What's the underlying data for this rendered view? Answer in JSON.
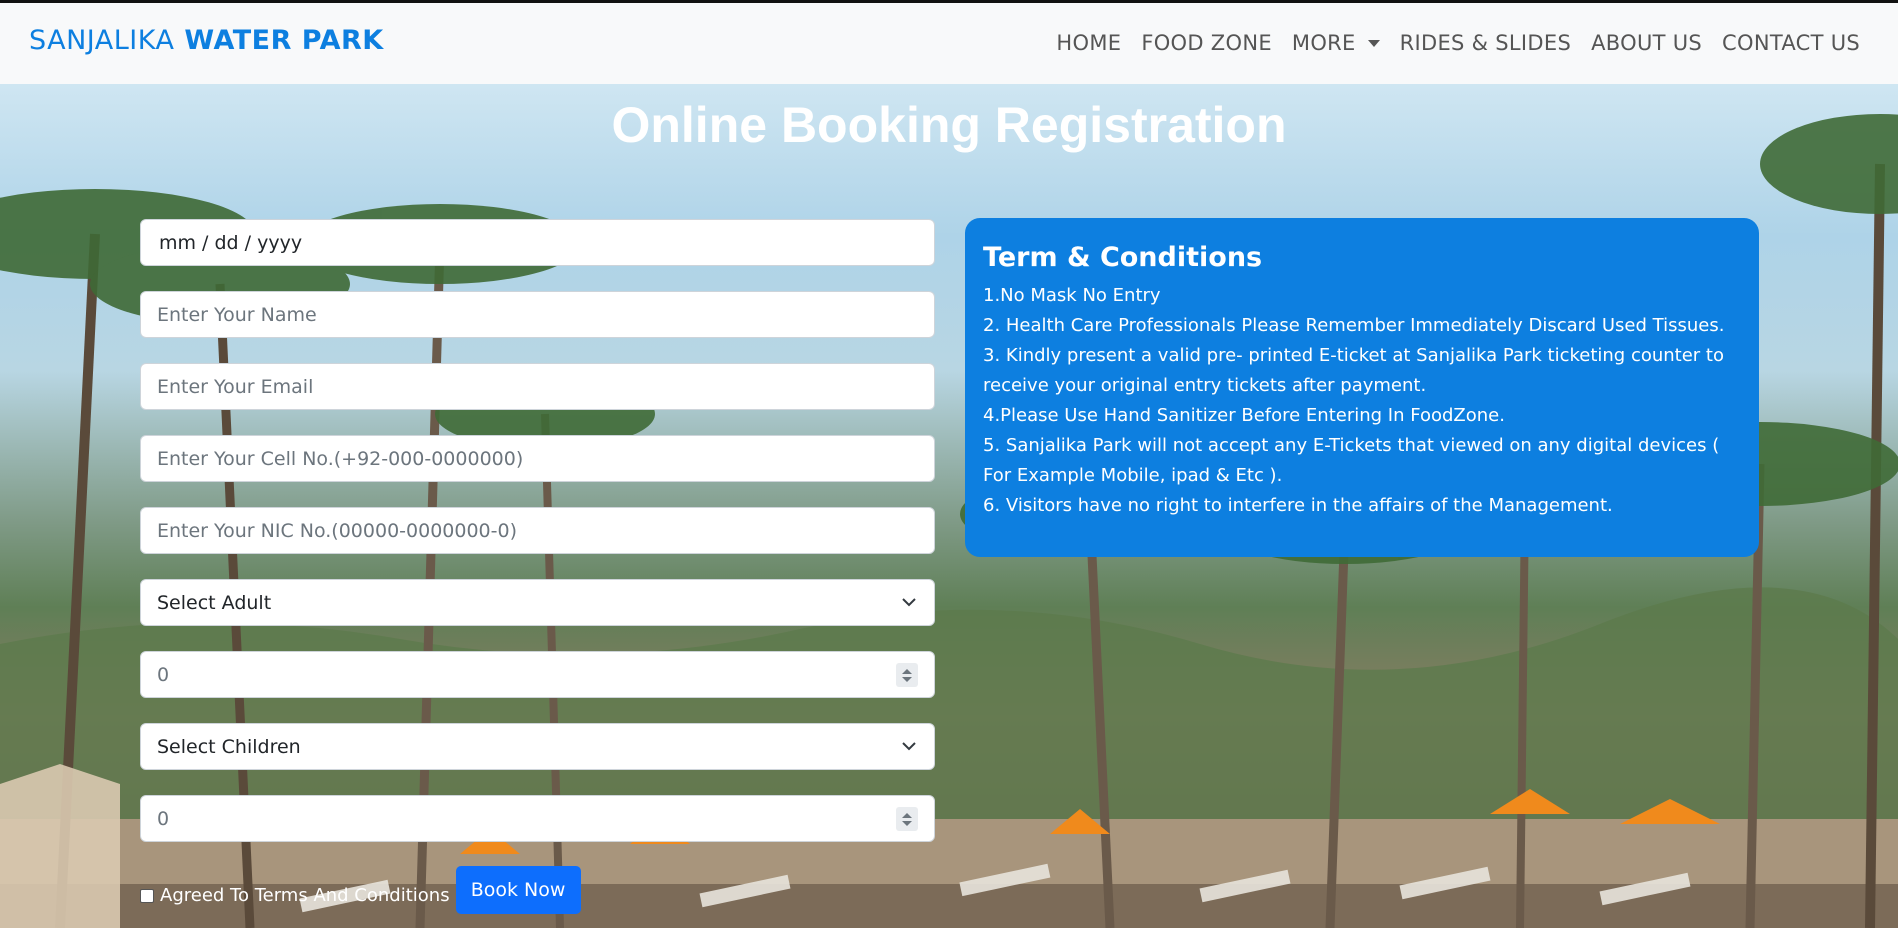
{
  "brand": {
    "part1": "SANJALIKA",
    "part2": "WATER PARK"
  },
  "nav": [
    "HOME",
    "FOOD ZONE",
    "MORE",
    "RIDES & SLIDES",
    "ABOUT US",
    "CONTACT US"
  ],
  "page_title": "Online Booking Registration",
  "form": {
    "date_placeholder": "mm / dd / yyyy",
    "name_placeholder": "Enter Your Name",
    "email_placeholder": "Enter Your Email",
    "cell_placeholder": "Enter Your Cell No.(+92-000-0000000)",
    "nic_placeholder": "Enter Your NIC No.(00000-0000000-0)",
    "adult_select": "Select Adult",
    "adult_count": "0",
    "children_select": "Select Children",
    "children_count": "0",
    "agree_label": "Agreed To Terms And Conditions",
    "book_button": "Book Now"
  },
  "terms": {
    "title": "Term & Conditions",
    "items": [
      "1.No Mask No Entry",
      "2. Health Care Professionals Please Remember Immediately Discard Used Tissues.",
      "3. Kindly present a valid pre- printed E-ticket at Sanjalika Park ticketing counter to receive your original entry tickets after payment.",
      "4.Please Use Hand Sanitizer Before Entering In FoodZone.",
      "5. Sanjalika Park will not accept any E-Tickets that viewed on any digital devices ( For Example Mobile, ipad & Etc ).",
      "6. Visitors have no right to interfere in the affairs of the Management."
    ]
  },
  "colors": {
    "brand": "#0d7fe0",
    "button": "#0d6efd",
    "terms_bg": "#0d7fe0"
  }
}
